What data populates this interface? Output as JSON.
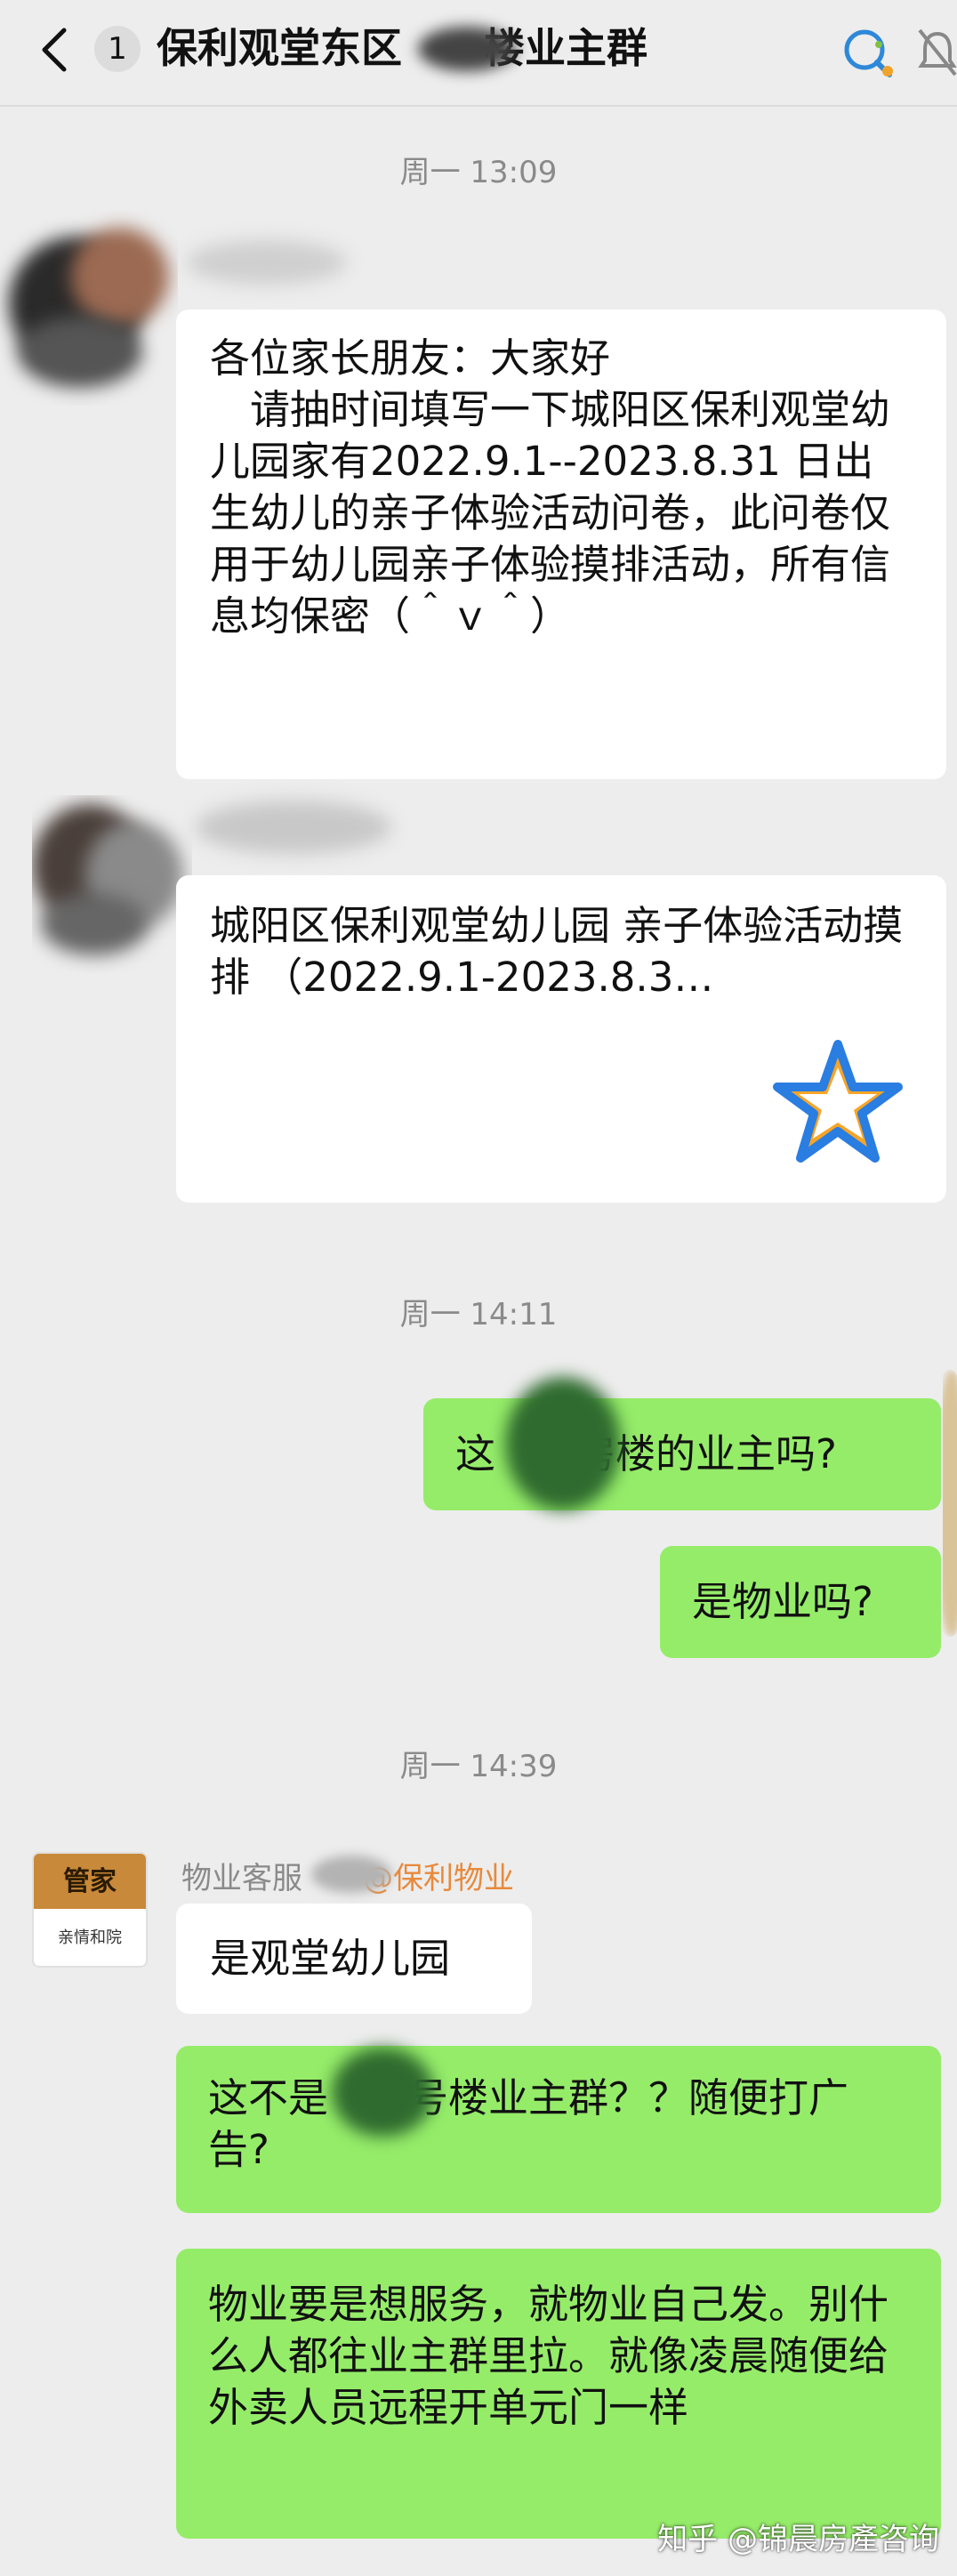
{
  "header": {
    "unread_count": "1",
    "title": "保利观堂东区　　楼业主群"
  },
  "messages": {
    "time1": "周一 13:09",
    "msg1": "各位家长朋友：大家好\n　请抽时间填写一下城阳区保利观堂幼儿园家有2022.9.1--2023.8.31 日出生幼儿的亲子体验活动问卷，此问卷仅用于幼儿园亲子体验摸排活动，所有信息均保密（＾ｖ＾）",
    "card_title": "城阳区保利观堂幼儿园 亲子体验活动摸排 （2022.9.1-2023.8.3…",
    "card_icon": "star-icon",
    "time2": "周一 14:11",
    "msg2": "这　　房楼的业主吗?",
    "msg3": "是物业吗?",
    "time3": "周一 14:39",
    "sender_name": "物业客服　　",
    "sender_org": "@保利物业",
    "avatar_top": "管家",
    "avatar_bottom": "亲情和院",
    "msg4": "是观堂幼儿园",
    "msg5": "这不是　　号楼业主群？？随便打广告?",
    "msg6": "物业要是想服务，就物业自己发。别什么人都往业主群里拉。就像凌晨随便给外卖人员远程开单元门一样"
  },
  "watermark": "知乎 @锦晨房產咨询",
  "colors": {
    "background": "#ededed",
    "bubble_self": "#95ec69",
    "bubble_other": "#ffffff",
    "org_text": "#e8893b"
  }
}
